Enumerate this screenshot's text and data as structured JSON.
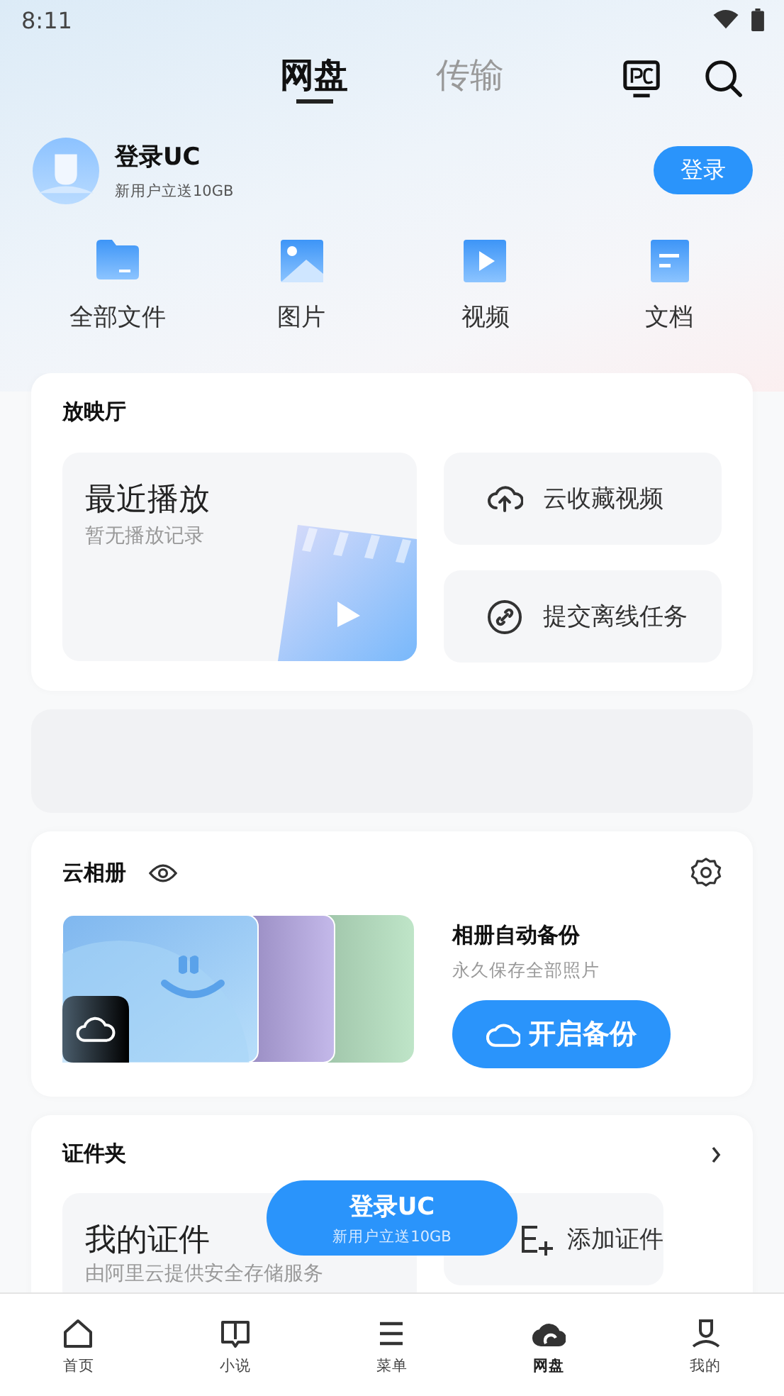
{
  "status_bar": {
    "time": "8:11"
  },
  "header": {
    "tabs": [
      {
        "label": "网盘",
        "selected": true
      },
      {
        "label": "传输",
        "selected": false
      }
    ]
  },
  "profile": {
    "name": "登录UC",
    "subtitle": "新用户立送10GB",
    "button": "登录"
  },
  "quick_links": [
    {
      "label": "全部文件"
    },
    {
      "label": "图片"
    },
    {
      "label": "视频"
    },
    {
      "label": "文档"
    }
  ],
  "theater": {
    "title": "放映厅",
    "recent": {
      "title": "最近播放",
      "subtitle": "暂无播放记录"
    },
    "actions": [
      {
        "label": "云收藏视频"
      },
      {
        "label": "提交离线任务"
      }
    ]
  },
  "album": {
    "title": "云相册",
    "feature_title": "相册自动备份",
    "feature_subtitle": "永久保存全部照片",
    "button": "开启备份"
  },
  "certificates": {
    "title": "证件夹",
    "mine": {
      "title": "我的证件",
      "subtitle": "由阿里云提供安全存储服务"
    },
    "add": "添加证件"
  },
  "floating_login": {
    "title": "登录UC",
    "subtitle": "新用户立送10GB"
  },
  "bottom_nav": [
    {
      "label": "首页",
      "selected": false
    },
    {
      "label": "小说",
      "selected": false
    },
    {
      "label": "菜单",
      "selected": false
    },
    {
      "label": "网盘",
      "selected": true
    },
    {
      "label": "我的",
      "selected": false
    }
  ]
}
